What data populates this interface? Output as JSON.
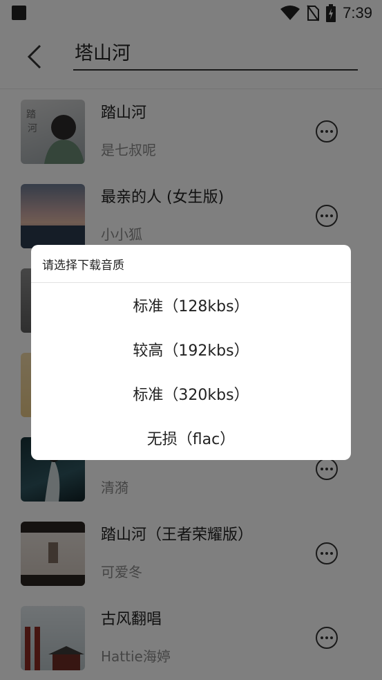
{
  "status_bar": {
    "time": "7:39",
    "icons": [
      "notification-square-icon",
      "wifi-icon",
      "no-sim-icon",
      "battery-charging-icon"
    ]
  },
  "header": {
    "back_icon": "back-arrow-icon",
    "search_value": "塔山河"
  },
  "songs": [
    {
      "title": "踏山河",
      "artist": "是七叔呢",
      "more_icon": "more-circle-icon"
    },
    {
      "title": "最亲的人 (女生版)",
      "artist": "小小狐",
      "more_icon": "more-circle-icon"
    },
    {
      "title": "",
      "artist": "",
      "more_icon": "more-circle-icon"
    },
    {
      "title": "",
      "artist": "",
      "more_icon": "more-circle-icon"
    },
    {
      "title": "",
      "artist": "清漪",
      "more_icon": "more-circle-icon"
    },
    {
      "title": "踏山河（王者荣耀版）",
      "artist": "可爱冬",
      "more_icon": "more-circle-icon"
    },
    {
      "title": "古风翻唱",
      "artist": "Hattie海婷",
      "more_icon": "more-circle-icon"
    }
  ],
  "dialog": {
    "title": "请选择下载音质",
    "options": [
      "标准（128kbs）",
      "较高（192kbs）",
      "标准（320kbs）",
      "无损（flac）"
    ]
  },
  "colors": {
    "overlay": "#000000",
    "text_primary": "#222222",
    "text_secondary": "#8a8a8a"
  }
}
